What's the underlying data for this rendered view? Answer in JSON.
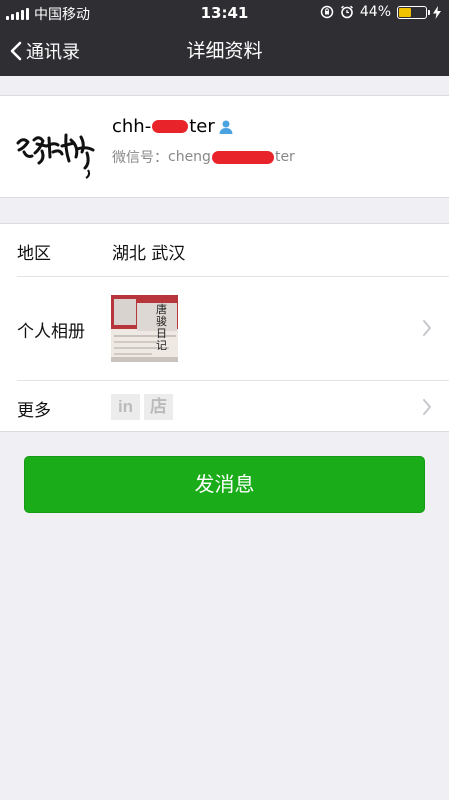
{
  "status_bar": {
    "carrier": "中国移动",
    "time": "13:41",
    "battery_text": "44%",
    "battery_level": 0.44,
    "battery_color": "#f2c200"
  },
  "nav": {
    "back_label": "通讯录",
    "title": "详细资料"
  },
  "profile": {
    "name_prefix": "chh-",
    "name_suffix": "ter",
    "wechat_id_label": "微信号：",
    "wechat_id_prefix": "cheng",
    "wechat_id_suffix": "ter",
    "redaction_color": "#e8232a",
    "contact_icon": "person-icon"
  },
  "details": {
    "region_label": "地区",
    "region_value": "湖北 武汉",
    "album_label": "个人相册",
    "album_thumb_text": "唐骏日记",
    "more_label": "更多",
    "more_icons": [
      "in",
      "店"
    ]
  },
  "actions": {
    "send_message_label": "发消息",
    "accent_color": "#1aad19"
  }
}
